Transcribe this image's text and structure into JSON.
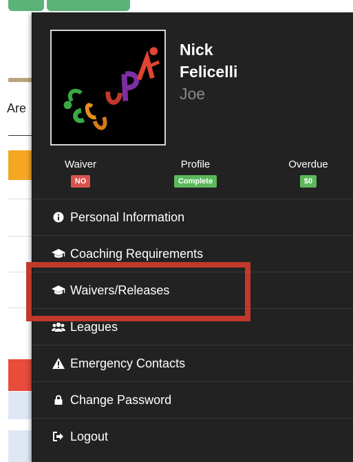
{
  "background": {
    "area_text": "Are"
  },
  "user": {
    "first_name": "Nick",
    "last_name": "Felicelli",
    "nickname": "Joe",
    "avatar_logo_text": "CUPA"
  },
  "stats": {
    "waiver": {
      "label": "Waiver",
      "value": "NO",
      "color": "#d9534f"
    },
    "profile": {
      "label": "Profile",
      "value": "Complete",
      "color": "#5cb85c"
    },
    "overdue": {
      "label": "Overdue",
      "value": "$0",
      "color": "#5cb85c"
    }
  },
  "menu": {
    "items": [
      {
        "label": "Personal Information",
        "icon": "info-circle-icon"
      },
      {
        "label": "Coaching Requirements",
        "icon": "graduation-cap-icon"
      },
      {
        "label": "Waivers/Releases",
        "icon": "graduation-cap-icon"
      },
      {
        "label": "Leagues",
        "icon": "users-icon"
      },
      {
        "label": "Emergency Contacts",
        "icon": "warning-icon"
      },
      {
        "label": "Change Password",
        "icon": "lock-icon"
      },
      {
        "label": "Logout",
        "icon": "sign-out-icon"
      }
    ]
  },
  "highlight": {
    "target": "Waivers/Releases",
    "color": "#c0392b"
  }
}
